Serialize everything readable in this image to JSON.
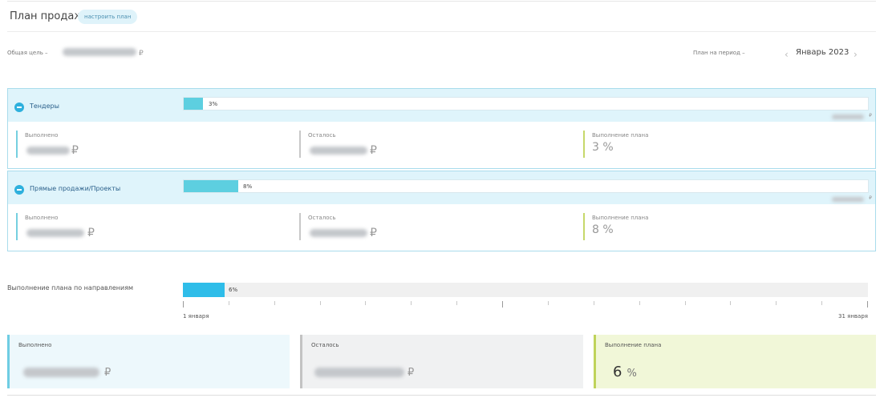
{
  "header": {
    "title": "План продаж",
    "setup_button": "настроить план",
    "goal_label": "Общая цель  –",
    "goal_currency": "₽",
    "period_label": "План на период  –",
    "period_value": "Январь 2023",
    "prev_icon": "chevron-left-icon",
    "next_icon": "chevron-right-icon"
  },
  "sections": [
    {
      "name": "Тендеры",
      "progress": 3,
      "progress_label": "3%",
      "plan_currency": "₽",
      "done_label": "Выполнено",
      "done_currency": "₽",
      "left_label": "Осталось",
      "left_currency": "₽",
      "completion_label": "Выполнение плана",
      "completion_value": "3 %"
    },
    {
      "name": "Прямые продажи/Проекты",
      "progress": 8,
      "progress_label": "8%",
      "plan_currency": "₽",
      "done_label": "Выполнено",
      "done_currency": "₽",
      "left_label": "Осталось",
      "left_currency": "₽",
      "completion_label": "Выполнение плана",
      "completion_value": "8 %"
    }
  ],
  "directions": {
    "label": "Выполнение плана по направлениям",
    "progress": 6,
    "progress_label": "6%",
    "start_day": "1 января",
    "end_day": "31 января"
  },
  "summary": {
    "done_label": "Выполнено",
    "done_currency": "₽",
    "left_label": "Осталось",
    "left_currency": "₽",
    "completion_label": "Выполнение плана",
    "completion_number": "6",
    "completion_unit": "%"
  },
  "colors": {
    "accent": "#2fbde9",
    "bar": "#5dcfe0",
    "section_bg": "#dff4fb",
    "done_card": "#edf8fc",
    "left_card": "#f0f1f2",
    "completion_card": "#f1f7d8"
  }
}
